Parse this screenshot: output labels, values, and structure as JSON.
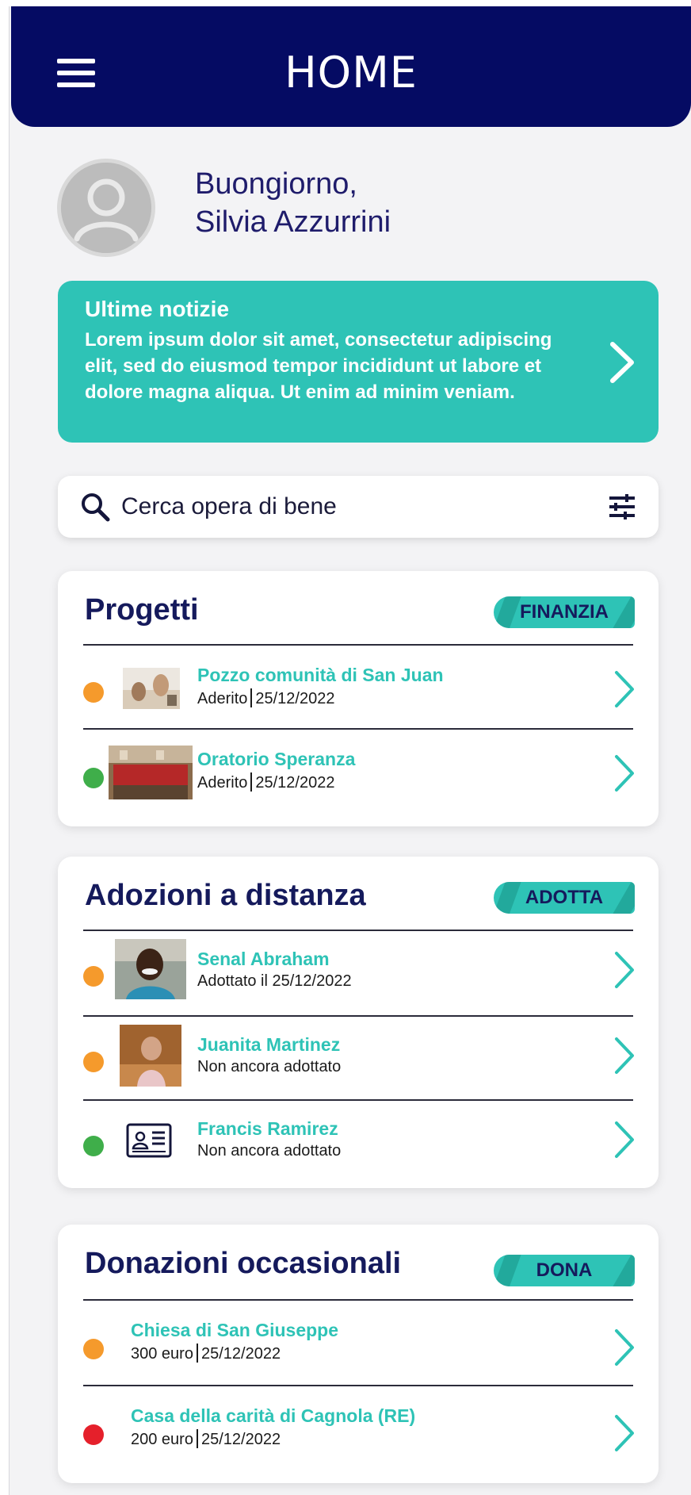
{
  "header": {
    "title": "HOME"
  },
  "greeting": {
    "line1": "Buongiorno,",
    "line2": "Silvia Azzurrini"
  },
  "news": {
    "title": "Ultime notizie",
    "body": "Lorem ipsum dolor sit amet, consectetur adipiscing elit, sed do eiusmod tempor incididunt ut labore et dolore magna aliqua. Ut enim ad minim veniam."
  },
  "search": {
    "placeholder": "Cerca opera di bene"
  },
  "colors": {
    "navy": "#050b63",
    "teal": "#2ec3b6",
    "orange": "#f59a2c",
    "green": "#3fae4a",
    "red": "#e5202b"
  },
  "sections": {
    "progetti": {
      "title": "Progetti",
      "action": "FINANZIA",
      "items": [
        {
          "name": "Pozzo comunità di San Juan",
          "status": "Aderito",
          "date": "25/12/2022",
          "dot": "orange"
        },
        {
          "name": "Oratorio Speranza",
          "status": "Aderito",
          "date": "25/12/2022",
          "dot": "green"
        }
      ]
    },
    "adozioni": {
      "title": "Adozioni a distanza",
      "action": "ADOTTA",
      "items": [
        {
          "name": "Senal Abraham",
          "status": "Adottato il 25/12/2022",
          "dot": "orange"
        },
        {
          "name": "Juanita Martinez",
          "status": "Non ancora adottato",
          "dot": "orange"
        },
        {
          "name": "Francis Ramirez",
          "status": "Non ancora adottato",
          "dot": "green"
        }
      ]
    },
    "donazioni": {
      "title": "Donazioni occasionali",
      "action": "DONA",
      "items": [
        {
          "name": "Chiesa di San Giuseppe",
          "amount": "300 euro",
          "date": "25/12/2022",
          "dot": "orange"
        },
        {
          "name": "Casa della carità di Cagnola (RE)",
          "amount": "200 euro",
          "date": "25/12/2022",
          "dot": "red"
        }
      ]
    }
  }
}
